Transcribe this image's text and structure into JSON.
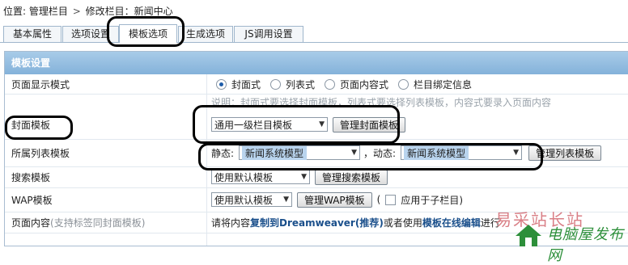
{
  "breadcrumb": {
    "prefix": "位置:",
    "root": "管理栏目",
    "separator": ">",
    "current": "修改栏目：新闻中心"
  },
  "tabs": [
    {
      "label": "基本属性"
    },
    {
      "label": "选项设置"
    },
    {
      "label": "模板选项"
    },
    {
      "label": "生成选项"
    },
    {
      "label": "JS调用设置"
    }
  ],
  "active_tab_index": 2,
  "panel": {
    "title": "模板设置",
    "rows": {
      "display_mode": {
        "label": "页面显示模式",
        "options": [
          "封面式",
          "列表式",
          "页面内容式",
          "栏目绑定信息"
        ],
        "selected_index": 0
      },
      "note": {
        "text": "说明：封面式要选择封面模板，列表式要选择列表模板，内容式要录入页面内容"
      },
      "cover_template": {
        "label": "封面模板",
        "select_value": "通用一级栏目模板",
        "button": "管理封面模板"
      },
      "list_template": {
        "label": "所属列表模板",
        "static_label": "静态:",
        "static_value": "新闻系统模型",
        "dynamic_label": "，动态:",
        "dynamic_value": "新闻系统模型",
        "button": "管理列表模板"
      },
      "search_template": {
        "label": "搜索模板",
        "select_value": "使用默认模板",
        "button": "管理搜索模板"
      },
      "wap_template": {
        "label": "WAP模板",
        "select_value": "使用默认模板",
        "button": "管理WAP模板",
        "paren_open": "(",
        "checkbox_label": "应用于子栏目)"
      },
      "page_content": {
        "label": "页面内容",
        "label_hint": "(支持标签同封面模板)",
        "text1": "请将内容",
        "link1": "复制到Dreamweaver(推荐)",
        "text2": "或者使用",
        "link2": "模板在线编辑",
        "text3": "进行"
      }
    }
  },
  "watermark": {
    "line1": "易采站长站",
    "line2": "电脑屋发布网"
  },
  "colors": {
    "panel_header": "#84b2da",
    "link": "#1a4f8b",
    "highlight": "#b9d4ee",
    "annotation": "#000000"
  }
}
